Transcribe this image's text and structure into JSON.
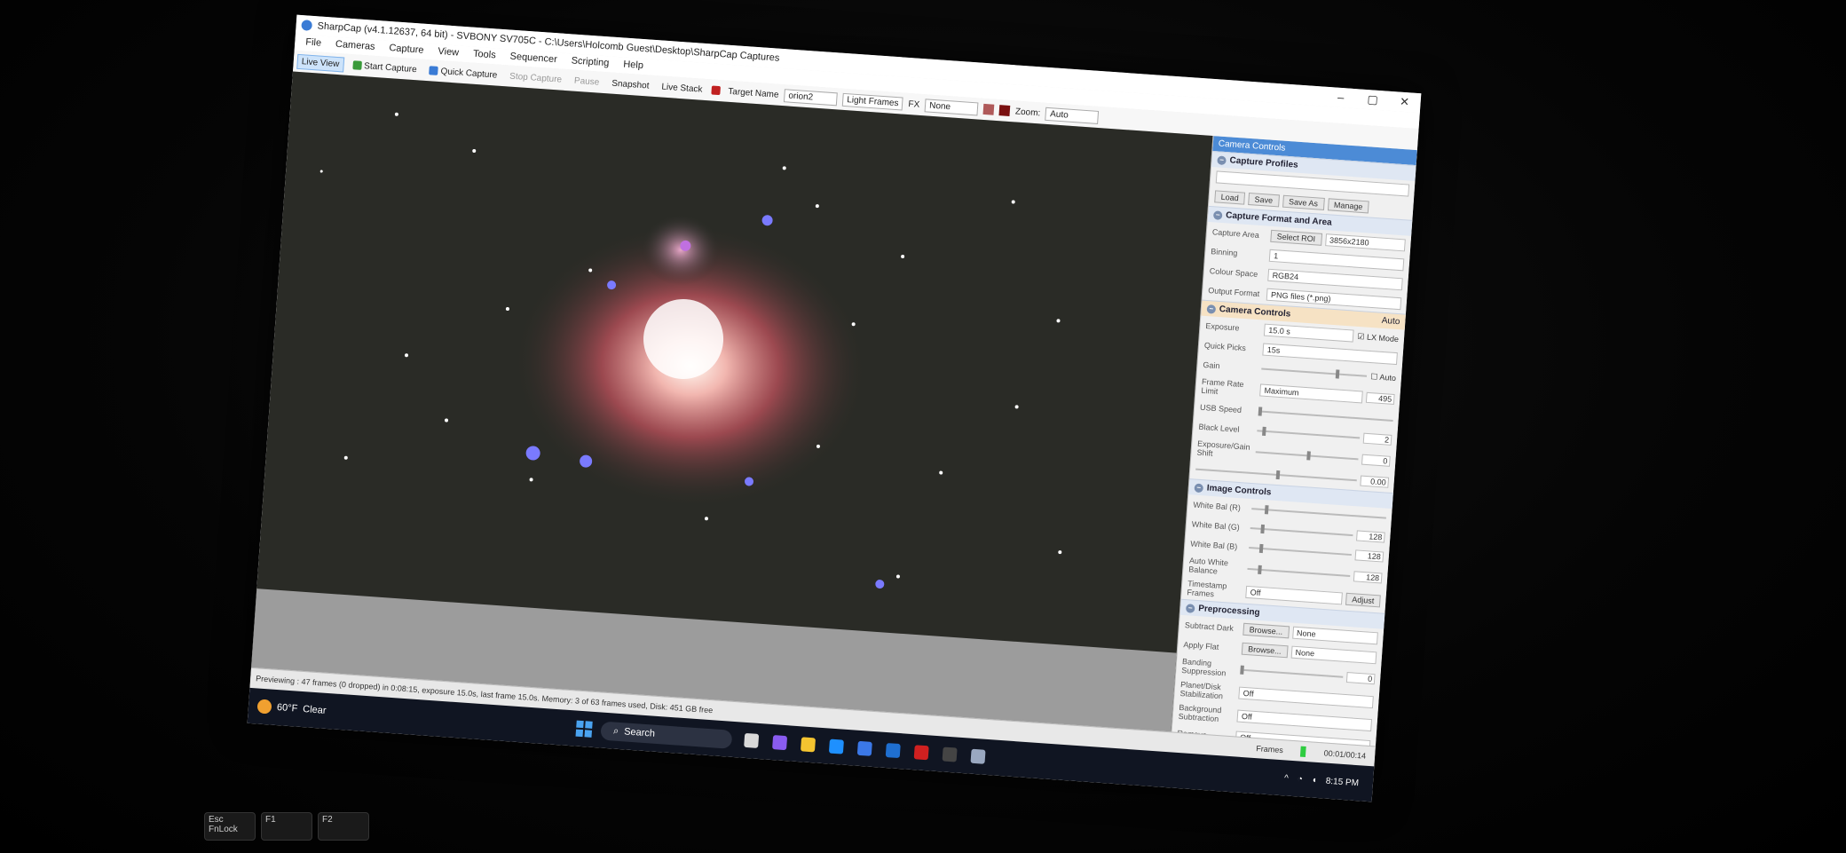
{
  "window": {
    "title": "SharpCap (v4.1.12637, 64 bit) - SVBONY SV705C - C:\\Users\\Holcomb Guest\\Desktop\\SharpCap Captures",
    "controls": [
      "minimize-icon",
      "maximize-icon",
      "close-icon"
    ]
  },
  "menu": [
    "File",
    "Cameras",
    "Capture",
    "View",
    "Tools",
    "Sequencer",
    "Scripting",
    "Help"
  ],
  "toolbar": {
    "live_view": "Live View",
    "start_capture": "Start Capture",
    "quick_capture": "Quick Capture",
    "stop_capture": "Stop Capture",
    "pause": "Pause",
    "snapshot": "Snapshot",
    "live_stack": "Live Stack",
    "target_name_label": "Target Name",
    "target_name_value": "orion2",
    "frame_type": "Light Frames",
    "fx_label": "FX",
    "fx_value": "None",
    "zoom_label": "Zoom:",
    "zoom_value": "Auto",
    "colors": {
      "active": "#cde3fa",
      "swatch_a": "#b05a5a",
      "swatch_b": "#7a1010"
    }
  },
  "panel": {
    "header": "Camera Controls",
    "capture_profiles": {
      "title": "Capture Profiles",
      "buttons": [
        "Load",
        "Save",
        "Save As",
        "Manage"
      ]
    },
    "capture_format": {
      "title": "Capture Format and Area",
      "capture_area_label": "Capture Area",
      "select_roi": "Select ROI",
      "capture_area_value": "3856x2180",
      "binning_label": "Binning",
      "binning_value": "1",
      "colour_space_label": "Colour Space",
      "colour_space_value": "RGB24",
      "output_format_label": "Output Format",
      "output_format_value": "PNG files (*.png)"
    },
    "camera_controls": {
      "title": "Camera Controls",
      "auto": "Auto",
      "exposure_label": "Exposure",
      "exposure_value": "15.0 s",
      "lx_mode": "LX Mode",
      "quick_picks_label": "Quick Picks",
      "quick_picks_value": "15s",
      "gain_label": "Gain",
      "gain_auto": "Auto",
      "frame_rate_label": "Frame Rate Limit",
      "frame_rate_num": "495",
      "frame_rate_value": "Maximum",
      "usb_speed_label": "USB Speed",
      "black_level_label": "Black Level",
      "black_level_value": "2",
      "exposure_gain_shift_label": "Exposure/Gain Shift",
      "exposure_gain_shift_value": "0",
      "extra_value": "0.00"
    },
    "image_controls": {
      "title": "Image Controls",
      "wb_r_label": "White Bal (R)",
      "wb_g_label": "White Bal (G)",
      "wb_g_value": "128",
      "wb_b_label": "White Bal (B)",
      "wb_b_value": "128",
      "auto_wb_label": "Auto White Balance",
      "auto_wb_value": "128",
      "timestamp_label": "Timestamp Frames",
      "timestamp_value": "Off",
      "adjust": "Adjust"
    },
    "preprocessing": {
      "title": "Preprocessing",
      "subtract_dark_label": "Subtract Dark",
      "subtract_dark_button": "Browse...",
      "subtract_dark_value": "None",
      "apply_flat_label": "Apply Flat",
      "apply_flat_button": "Browse...",
      "apply_flat_value": "None",
      "banding_label": "Banding Suppression",
      "banding_value": "0",
      "planet_label": "Planet/Disk Stabilization",
      "planet_value": "Off",
      "background_label": "Background Subtraction",
      "background_value": "Off",
      "remove_label": "Remove",
      "remove_value": "Off"
    }
  },
  "status": {
    "text": "Previewing : 47 frames (0 dropped) in 0:08:15, exposure 15.0s, last frame 15.0s. Memory: 3 of 63 frames used, Disk: 451 GB free",
    "frames_label": "Frames",
    "time": "00:01/00:14"
  },
  "taskbar": {
    "weather_temp": "60°F",
    "weather_text": "Clear",
    "search": "Search",
    "clock": "8:15 PM"
  },
  "keyboard": {
    "esc": "Esc",
    "fnlock": "FnLock",
    "f1": "F1",
    "f2": "F2"
  }
}
